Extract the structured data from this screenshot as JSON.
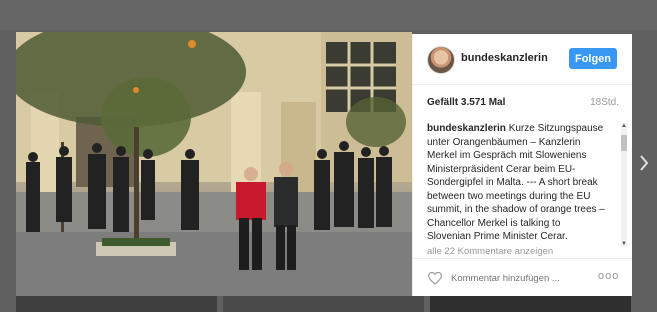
{
  "post": {
    "username": "bundeskanzlerin",
    "follow_label": "Folgen",
    "likes": "Gefällt 3.571 Mal",
    "time_ago": "18Std.",
    "caption_user": "bundeskanzlerin",
    "caption_text": "Kurze Sitzungspause unter Orangenbäumen – Kanzlerin Merkel im Gespräch mit Sloweniens Ministerpräsident Cerar beim EU-Sondergipfel in Malta. --- A short break between two meetings during the EU summit, in the shadow of orange trees – Chancellor Merkel is talking to Slovenian Prime Minister Cerar.",
    "view_all_comments": "alle 22 Kommentare anzeigen",
    "comment_placeholder": "Kommentar hinzufügen ...",
    "more_options": "ooo"
  },
  "icons": {
    "heart": "heart-icon",
    "next": "chevron-right-icon",
    "more": "more-options-icon"
  },
  "colors": {
    "follow_button": "#3897f0",
    "backdrop": "#606060"
  }
}
